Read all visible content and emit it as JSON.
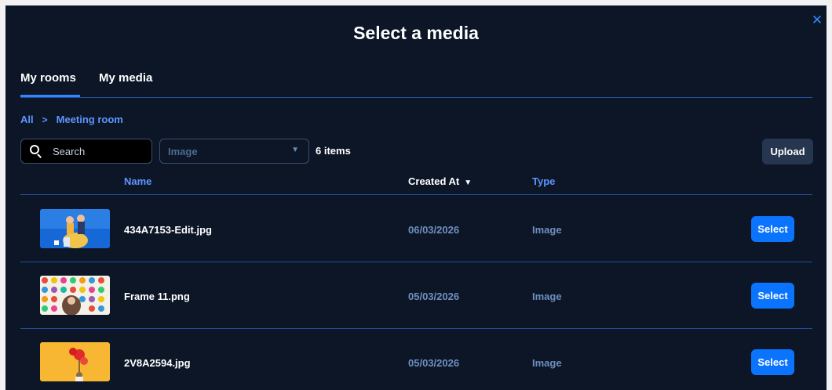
{
  "modal": {
    "title": "Select a media",
    "close_icon": "close-icon"
  },
  "tabs": [
    {
      "label": "My rooms",
      "active": true
    },
    {
      "label": "My media",
      "active": false
    }
  ],
  "breadcrumb": {
    "root": "All",
    "separator": ">",
    "current": "Meeting room"
  },
  "toolbar": {
    "search_placeholder": "Search",
    "type_filter": "Image",
    "item_count": "6 items",
    "upload_label": "Upload"
  },
  "table": {
    "columns": {
      "name": "Name",
      "created": "Created At",
      "type": "Type"
    },
    "sort_column": "Created At",
    "rows": [
      {
        "name": "434A7153-Edit.jpg",
        "created": "06/03/2026",
        "type": "Image",
        "action": "Select"
      },
      {
        "name": "Frame 11.png",
        "created": "05/03/2026",
        "type": "Image",
        "action": "Select"
      },
      {
        "name": "2V8A2594.jpg",
        "created": "05/03/2026",
        "type": "Image",
        "action": "Select"
      }
    ]
  },
  "colors": {
    "background": "#0c1627",
    "accent": "#0a74ff",
    "link": "#5f95ff",
    "divider": "#1f4f99"
  }
}
